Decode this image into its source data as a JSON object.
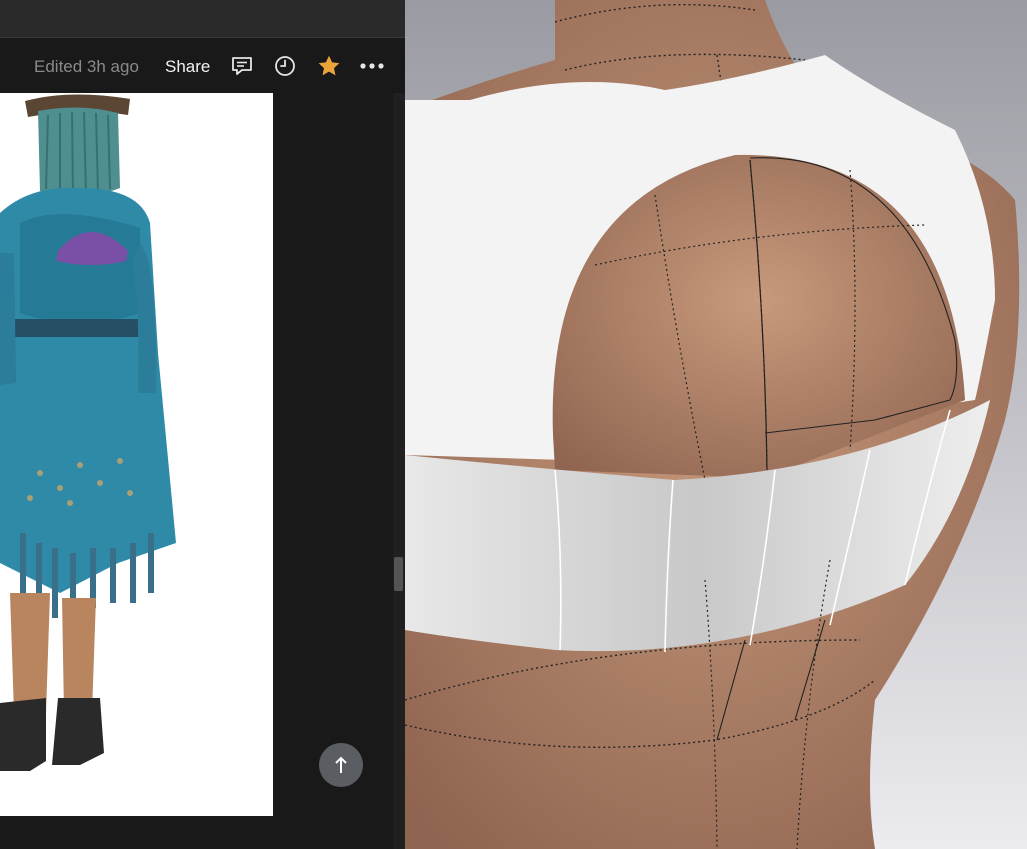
{
  "toolbar": {
    "edited_text": "Edited 3h ago",
    "share_label": "Share",
    "icons": [
      "comment-icon",
      "history-icon",
      "star-icon",
      "more-icon"
    ],
    "star_color": "#e9a53a"
  },
  "colors": {
    "panel_bg": "#191919",
    "topbar_bg": "#2a2a2a",
    "muted_text": "#8a8a8a",
    "viewport_bg": "#c9c9cd",
    "garment": "#f2f2f2",
    "skin": "#b88a6c"
  },
  "reference_image": {
    "subject": "costume back view"
  },
  "scroll_to_top": {
    "icon": "arrow-up-icon"
  }
}
